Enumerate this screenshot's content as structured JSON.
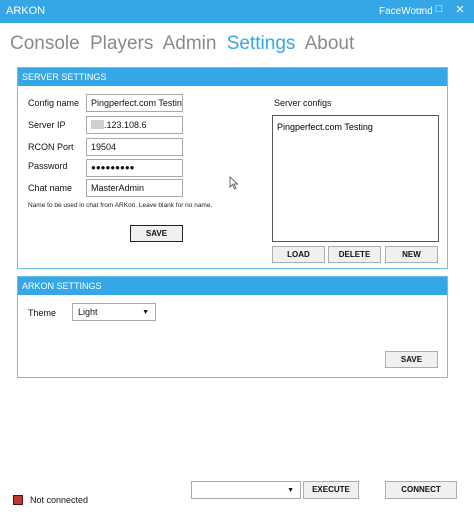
{
  "window": {
    "app_name": "ARKON",
    "user": "FaceWound",
    "minimize": "–",
    "maximize": "□",
    "close": "✕"
  },
  "nav": {
    "console": "Console",
    "players": "Players",
    "admin": "Admin",
    "settings": "Settings",
    "about": "About"
  },
  "server_settings": {
    "title": "SERVER SETTINGS",
    "config_name_label": "Config name",
    "config_name_value": "Pingperfect.com Testing",
    "server_ip_label": "Server IP",
    "server_ip_value": ".123.108.6",
    "rcon_port_label": "RCON Port",
    "rcon_port_value": "19504",
    "password_label": "Password",
    "password_value": "●●●●●●●●●",
    "chat_name_label": "Chat name",
    "chat_name_value": "MasterAdmin",
    "hint": "Name to be used in chat from ARKon. Leave blank for no name.",
    "save_label": "SAVE",
    "configs_label": "Server configs",
    "configs": [
      "Pingperfect.com Testing"
    ],
    "load_label": "LOAD",
    "delete_label": "DELETE",
    "new_label": "NEW"
  },
  "arkon_settings": {
    "title": "ARKON SETTINGS",
    "theme_label": "Theme",
    "theme_value": "Light",
    "save_label": "SAVE"
  },
  "footer": {
    "status": "Not connected",
    "status_color": "#c0392b",
    "command_value": "",
    "execute_label": "EXECUTE",
    "connect_label": "CONNECT"
  }
}
